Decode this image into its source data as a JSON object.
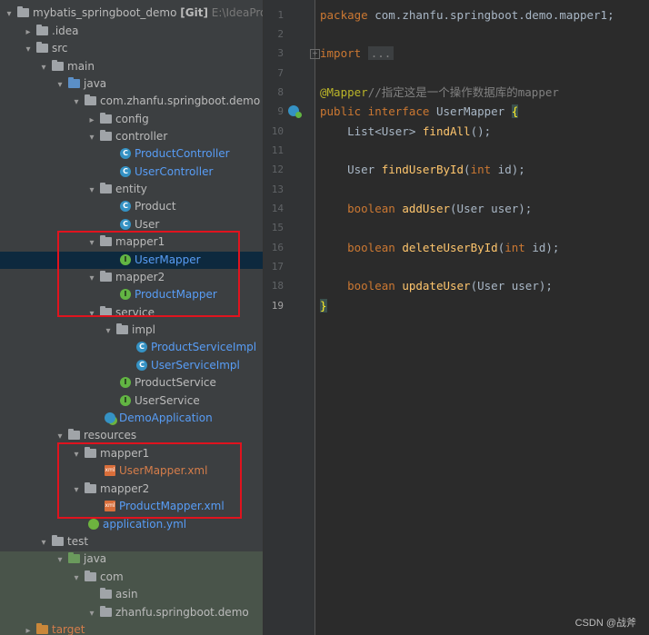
{
  "project_tree": {
    "root": {
      "name": "mybatis_springboot_demo",
      "git": "[Git]",
      "path": "E:\\IdeaPro"
    },
    "items": [
      {
        "label": ".idea"
      },
      {
        "label": "src"
      },
      {
        "label": "main"
      },
      {
        "label": "java"
      },
      {
        "label": "com.zhanfu.springboot.demo"
      },
      {
        "label": "config"
      },
      {
        "label": "controller"
      },
      {
        "label": "ProductController"
      },
      {
        "label": "UserController"
      },
      {
        "label": "entity"
      },
      {
        "label": "Product"
      },
      {
        "label": "User"
      },
      {
        "label": "mapper1"
      },
      {
        "label": "UserMapper"
      },
      {
        "label": "mapper2"
      },
      {
        "label": "ProductMapper"
      },
      {
        "label": "service"
      },
      {
        "label": "impl"
      },
      {
        "label": "ProductServiceImpl"
      },
      {
        "label": "UserServiceImpl"
      },
      {
        "label": "ProductService"
      },
      {
        "label": "UserService"
      },
      {
        "label": "DemoApplication"
      },
      {
        "label": "resources"
      },
      {
        "label": "mapper1"
      },
      {
        "label": "UserMapper.xml"
      },
      {
        "label": "mapper2"
      },
      {
        "label": "ProductMapper.xml"
      },
      {
        "label": "application.yml"
      },
      {
        "label": "test"
      },
      {
        "label": "java"
      },
      {
        "label": "com"
      },
      {
        "label": "asin"
      },
      {
        "label": "zhanfu.springboot.demo"
      },
      {
        "label": "target"
      }
    ],
    "icon_letters": {
      "class": "C",
      "interface": "I",
      "xml": "xml"
    }
  },
  "editor": {
    "line_numbers": [
      "1",
      "2",
      "3",
      "7",
      "8",
      "9",
      "10",
      "11",
      "12",
      "13",
      "14",
      "15",
      "16",
      "17",
      "18",
      "19"
    ],
    "code": {
      "l1_kw": "package",
      "l1_rest": " com.zhanfu.springboot.demo.mapper1;",
      "l3_kw": "import",
      "l3_dots": "...",
      "l8_annotation": "@Mapper",
      "l8_comment": "//指定这是一个操作数据库的mapper",
      "l9_kw": "public interface",
      "l9_name": " UserMapper ",
      "l9_brace": "{",
      "l10_type": "    List<User> ",
      "l10_fn": "findAll",
      "l10_rest": "();",
      "l12_type": "    User ",
      "l12_fn": "findUserById",
      "l12_p1": "(",
      "l12_kw": "int",
      "l12_rest": " id);",
      "l14_kw": "    boolean",
      "l14_sp": " ",
      "l14_fn": "addUser",
      "l14_rest": "(User user);",
      "l16_kw": "    boolean",
      "l16_sp": " ",
      "l16_fn": "deleteUserById",
      "l16_p1": "(",
      "l16_kw2": "int",
      "l16_rest": " id);",
      "l18_kw": "    boolean",
      "l18_sp": " ",
      "l18_fn": "updateUser",
      "l18_rest": "(User user);",
      "l19_brace": "}"
    }
  },
  "watermark": "CSDN @战斧",
  "colors": {
    "highlight_box": "#e0131e",
    "selection": "#0d293e",
    "class_icon": "#3592c4",
    "interface_icon": "#62b543"
  }
}
